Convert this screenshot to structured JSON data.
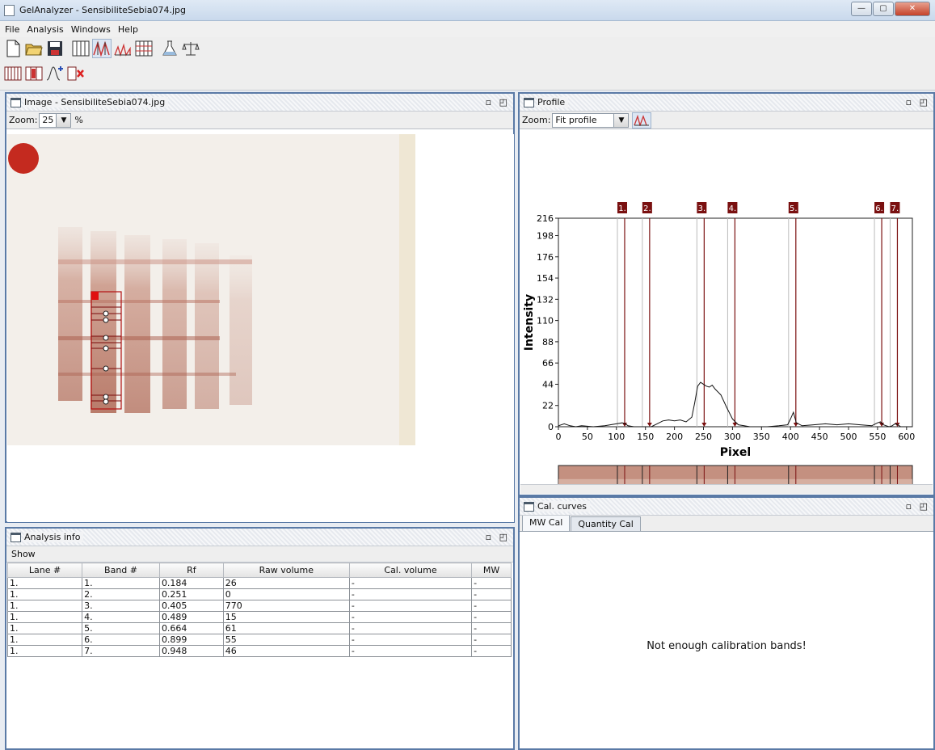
{
  "window": {
    "title": "GelAnalyzer - SensibiliteSebia074.jpg",
    "min": "—",
    "max": "▢",
    "close": "✕"
  },
  "menu": [
    "File",
    "Analysis",
    "Windows",
    "Help"
  ],
  "toolbar_icons": [
    "new-file-icon",
    "open-folder-icon",
    "save-icon",
    "lanes-icon",
    "peaks-icon",
    "profile-peaks-icon",
    "grid-icon",
    "flask-icon",
    "balance-icon"
  ],
  "toolbar2_icons": [
    "multi-lane-icon",
    "lane-select-icon",
    "add-profile-icon",
    "delete-lane-icon"
  ],
  "image_pane": {
    "title": "Image - SensibiliteSebia074.jpg",
    "zoom_label": "Zoom:",
    "zoom_value": "25",
    "zoom_unit": "%"
  },
  "profile_pane": {
    "title": "Profile",
    "zoom_label": "Zoom:",
    "zoom_value": "Fit profile"
  },
  "cal_pane": {
    "title": "Cal. curves",
    "tabs": [
      "MW Cal",
      "Quantity Cal"
    ],
    "message": "Not enough calibration bands!"
  },
  "info_pane": {
    "title": "Analysis info",
    "show": "Show",
    "columns": [
      "Lane #",
      "Band #",
      "Rf",
      "Raw volume",
      "Cal. volume",
      "MW"
    ],
    "rows": [
      [
        "1.",
        "1.",
        "0.184",
        "26",
        "-",
        "-"
      ],
      [
        "1.",
        "2.",
        "0.251",
        "0",
        "-",
        "-"
      ],
      [
        "1.",
        "3.",
        "0.405",
        "770",
        "-",
        "-"
      ],
      [
        "1.",
        "4.",
        "0.489",
        "15",
        "-",
        "-"
      ],
      [
        "1.",
        "5.",
        "0.664",
        "61",
        "-",
        "-"
      ],
      [
        "1.",
        "6.",
        "0.899",
        "55",
        "-",
        "-"
      ],
      [
        "1.",
        "7.",
        "0.948",
        "46",
        "-",
        "-"
      ]
    ]
  },
  "chart_data": {
    "type": "line",
    "xlabel": "Pixel",
    "ylabel": "Intensity",
    "xlim": [
      0,
      610
    ],
    "ylim": [
      0,
      216
    ],
    "xticks": [
      0,
      50,
      100,
      150,
      200,
      250,
      300,
      350,
      400,
      450,
      500,
      550,
      600
    ],
    "yticks": [
      0,
      22,
      44,
      66,
      88,
      110,
      132,
      154,
      176,
      198,
      216
    ],
    "series": [
      {
        "x": [
          0,
          10,
          20,
          30,
          40,
          60,
          80,
          100,
          110,
          115,
          120,
          130,
          140,
          150,
          160,
          170,
          180,
          190,
          200,
          210,
          220,
          230,
          235,
          240,
          245,
          250,
          255,
          260,
          265,
          270,
          280,
          290,
          300,
          310,
          320,
          330,
          340,
          360,
          380,
          395,
          400,
          405,
          410,
          420,
          440,
          460,
          480,
          500,
          520,
          540,
          550,
          555,
          560,
          565,
          570,
          575,
          580,
          585,
          590,
          600,
          610
        ],
        "y": [
          1,
          3,
          1,
          0,
          1,
          0,
          1,
          3,
          4,
          3,
          1,
          0,
          0,
          0,
          0,
          3,
          6,
          7,
          6,
          7,
          5,
          10,
          25,
          42,
          46,
          44,
          42,
          41,
          43,
          39,
          33,
          20,
          8,
          2,
          1,
          0,
          0,
          0,
          1,
          2,
          8,
          15,
          4,
          1,
          2,
          3,
          2,
          3,
          2,
          1,
          4,
          5,
          2,
          1,
          0,
          1,
          3,
          2,
          0,
          0,
          0
        ]
      }
    ],
    "bands": [
      {
        "label": "1.",
        "x": 110
      },
      {
        "label": "2.",
        "x": 153
      },
      {
        "label": "3.",
        "x": 247
      },
      {
        "label": "4.",
        "x": 300
      },
      {
        "label": "5.",
        "x": 405
      },
      {
        "label": "6.",
        "x": 553
      },
      {
        "label": "7.",
        "x": 580
      }
    ]
  }
}
